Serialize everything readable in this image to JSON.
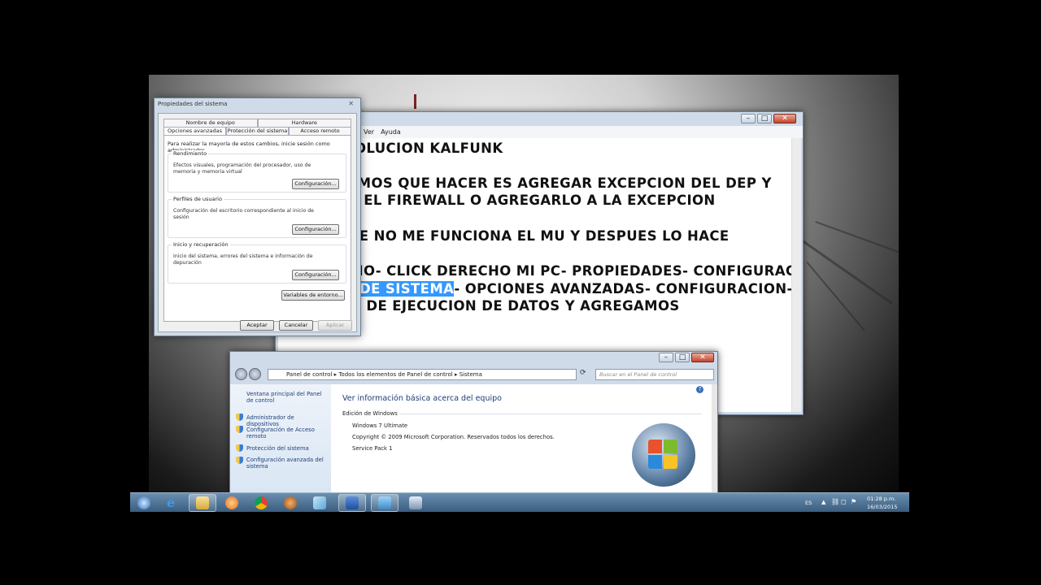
{
  "notepad": {
    "menu": [
      "Ver",
      "Ayuda"
    ],
    "lines": [
      "OLUCION KALFUNK",
      "EMOS QUE HACER ES AGREGAR EXCEPCION DEL DEP Y",
      "R EL FIREWALL O AGREGARLO A LA EXCEPCION",
      "UE NO ME FUNCIONA EL MU Y DESPUES LO HACE",
      "CIO- CLICK DERECHO MI PC- PROPIEDADES- CONFIGURACION",
      "- OPCIONES AVANZADAS- CONFIGURACION-",
      "N DE EJECUCION DE DATOS Y  AGREGAMOS"
    ],
    "selected_text": "DE SISTEMA"
  },
  "sysprops": {
    "title": "Propiedades del sistema",
    "close_label": "✕",
    "tabs_row1": [
      "Nombre de equipo",
      "Hardware"
    ],
    "tabs_row2": [
      "Opciones avanzadas",
      "Protección del sistema",
      "Acceso remoto"
    ],
    "intro": "Para realizar la mayoría de estos cambios, inicie sesión como administrador.",
    "groups": [
      {
        "label": "Rendimiento",
        "desc": "Efectos visuales, programación del procesador, uso de memoria y memoria virtual",
        "button": "Configuración..."
      },
      {
        "label": "Perfiles de usuario",
        "desc": "Configuración del escritorio correspondiente al inicio de sesión",
        "button": "Configuración..."
      },
      {
        "label": "Inicio y recuperación",
        "desc": "Inicio del sistema, errores del sistema e información de depuración",
        "button": "Configuración..."
      }
    ],
    "env_button": "Variables de entorno...",
    "ok": "Aceptar",
    "cancel": "Cancelar",
    "apply": "Aplicar"
  },
  "cpanel": {
    "breadcrumb": [
      "Panel de control",
      "Todos los elementos de Panel de control",
      "Sistema"
    ],
    "search_placeholder": "Buscar en el Panel de control",
    "left_links": [
      "Ventana principal del Panel de control",
      "Administrador de dispositivos",
      "Configuración de Acceso remoto",
      "Protección del sistema",
      "Configuración avanzada del sistema"
    ],
    "heading": "Ver información básica acerca del equipo",
    "section": "Edición de Windows",
    "edition": "Windows 7 Ultimate",
    "copyright": "Copyright © 2009 Microsoft Corporation. Reservados todos los derechos.",
    "service_pack": "Service Pack 1"
  },
  "taskbar": {
    "lang": "ES",
    "time": "01:28 p.m.",
    "date": "16/03/2015",
    "icons": [
      "start-orb",
      "internet-explorer",
      "file-explorer",
      "media-player",
      "chrome",
      "app-glove",
      "app-generic",
      "word",
      "control-panel",
      "network-app"
    ]
  },
  "colors": {
    "selection": "#3399ff",
    "taskbar": "#3b5d7e",
    "link": "#1e3d78"
  }
}
